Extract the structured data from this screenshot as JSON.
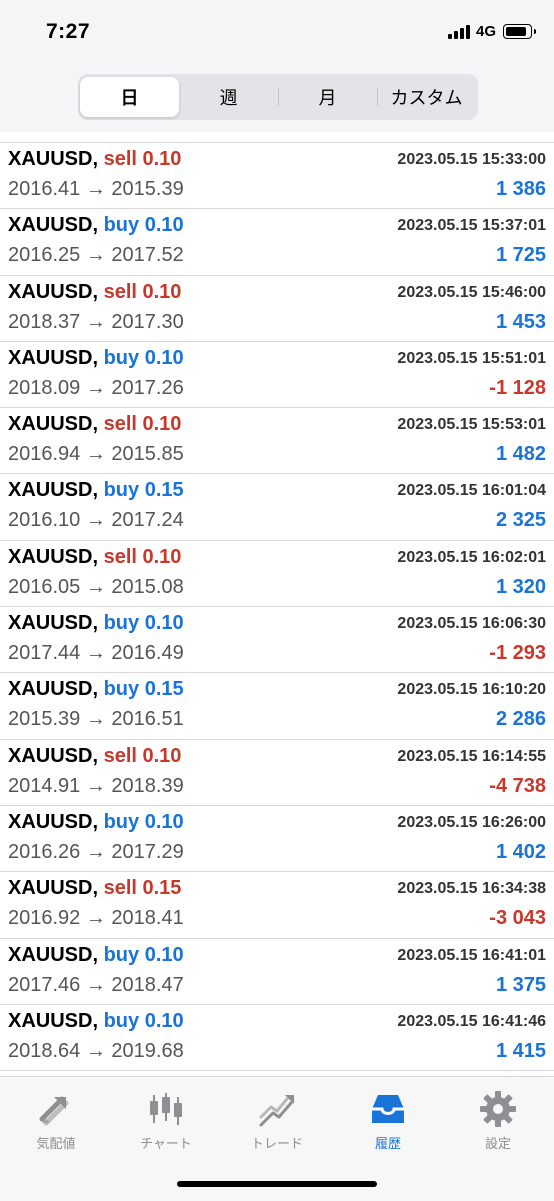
{
  "status": {
    "time": "7:27",
    "network": "4G"
  },
  "segments": [
    {
      "label": "日",
      "active": true
    },
    {
      "label": "週",
      "active": false
    },
    {
      "label": "月",
      "active": false
    },
    {
      "label": "カスタム",
      "active": false
    }
  ],
  "trades": [
    {
      "symbol": "XAUUSD,",
      "side": "sell",
      "lot": "sell 0.10",
      "time": "2023.05.15 15:33:00",
      "open": "2016.41",
      "close": "2015.39",
      "profit": "1 386",
      "profit_sign": "pos"
    },
    {
      "symbol": "XAUUSD,",
      "side": "buy",
      "lot": "buy 0.10",
      "time": "2023.05.15 15:37:01",
      "open": "2016.25",
      "close": "2017.52",
      "profit": "1 725",
      "profit_sign": "pos"
    },
    {
      "symbol": "XAUUSD,",
      "side": "sell",
      "lot": "sell 0.10",
      "time": "2023.05.15 15:46:00",
      "open": "2018.37",
      "close": "2017.30",
      "profit": "1 453",
      "profit_sign": "pos"
    },
    {
      "symbol": "XAUUSD,",
      "side": "buy",
      "lot": "buy 0.10",
      "time": "2023.05.15 15:51:01",
      "open": "2018.09",
      "close": "2017.26",
      "profit": "-1 128",
      "profit_sign": "neg"
    },
    {
      "symbol": "XAUUSD,",
      "side": "sell",
      "lot": "sell 0.10",
      "time": "2023.05.15 15:53:01",
      "open": "2016.94",
      "close": "2015.85",
      "profit": "1 482",
      "profit_sign": "pos"
    },
    {
      "symbol": "XAUUSD,",
      "side": "buy",
      "lot": "buy 0.15",
      "time": "2023.05.15 16:01:04",
      "open": "2016.10",
      "close": "2017.24",
      "profit": "2 325",
      "profit_sign": "pos"
    },
    {
      "symbol": "XAUUSD,",
      "side": "sell",
      "lot": "sell 0.10",
      "time": "2023.05.15 16:02:01",
      "open": "2016.05",
      "close": "2015.08",
      "profit": "1 320",
      "profit_sign": "pos"
    },
    {
      "symbol": "XAUUSD,",
      "side": "buy",
      "lot": "buy 0.10",
      "time": "2023.05.15 16:06:30",
      "open": "2017.44",
      "close": "2016.49",
      "profit": "-1 293",
      "profit_sign": "neg"
    },
    {
      "symbol": "XAUUSD,",
      "side": "buy",
      "lot": "buy 0.15",
      "time": "2023.05.15 16:10:20",
      "open": "2015.39",
      "close": "2016.51",
      "profit": "2 286",
      "profit_sign": "pos"
    },
    {
      "symbol": "XAUUSD,",
      "side": "sell",
      "lot": "sell 0.10",
      "time": "2023.05.15 16:14:55",
      "open": "2014.91",
      "close": "2018.39",
      "profit": "-4 738",
      "profit_sign": "neg"
    },
    {
      "symbol": "XAUUSD,",
      "side": "buy",
      "lot": "buy 0.10",
      "time": "2023.05.15 16:26:00",
      "open": "2016.26",
      "close": "2017.29",
      "profit": "1 402",
      "profit_sign": "pos"
    },
    {
      "symbol": "XAUUSD,",
      "side": "sell",
      "lot": "sell 0.15",
      "time": "2023.05.15 16:34:38",
      "open": "2016.92",
      "close": "2018.41",
      "profit": "-3 043",
      "profit_sign": "neg"
    },
    {
      "symbol": "XAUUSD,",
      "side": "buy",
      "lot": "buy 0.10",
      "time": "2023.05.15 16:41:01",
      "open": "2017.46",
      "close": "2018.47",
      "profit": "1 375",
      "profit_sign": "pos"
    },
    {
      "symbol": "XAUUSD,",
      "side": "buy",
      "lot": "buy 0.10",
      "time": "2023.05.15 16:41:46",
      "open": "2018.64",
      "close": "2019.68",
      "profit": "1 415",
      "profit_sign": "pos"
    }
  ],
  "arrow": "→",
  "tabs": [
    {
      "label": "気配値",
      "icon": "quotes-icon",
      "active": false
    },
    {
      "label": "チャート",
      "icon": "chart-icon",
      "active": false
    },
    {
      "label": "トレード",
      "icon": "trade-icon",
      "active": false
    },
    {
      "label": "履歴",
      "icon": "history-icon",
      "active": true
    },
    {
      "label": "設定",
      "icon": "settings-icon",
      "active": false
    }
  ],
  "colors": {
    "buy": "#1a74d8",
    "sell": "#c8382a",
    "active_tab": "#1a74d8",
    "inactive_tab": "#8e8e93"
  }
}
